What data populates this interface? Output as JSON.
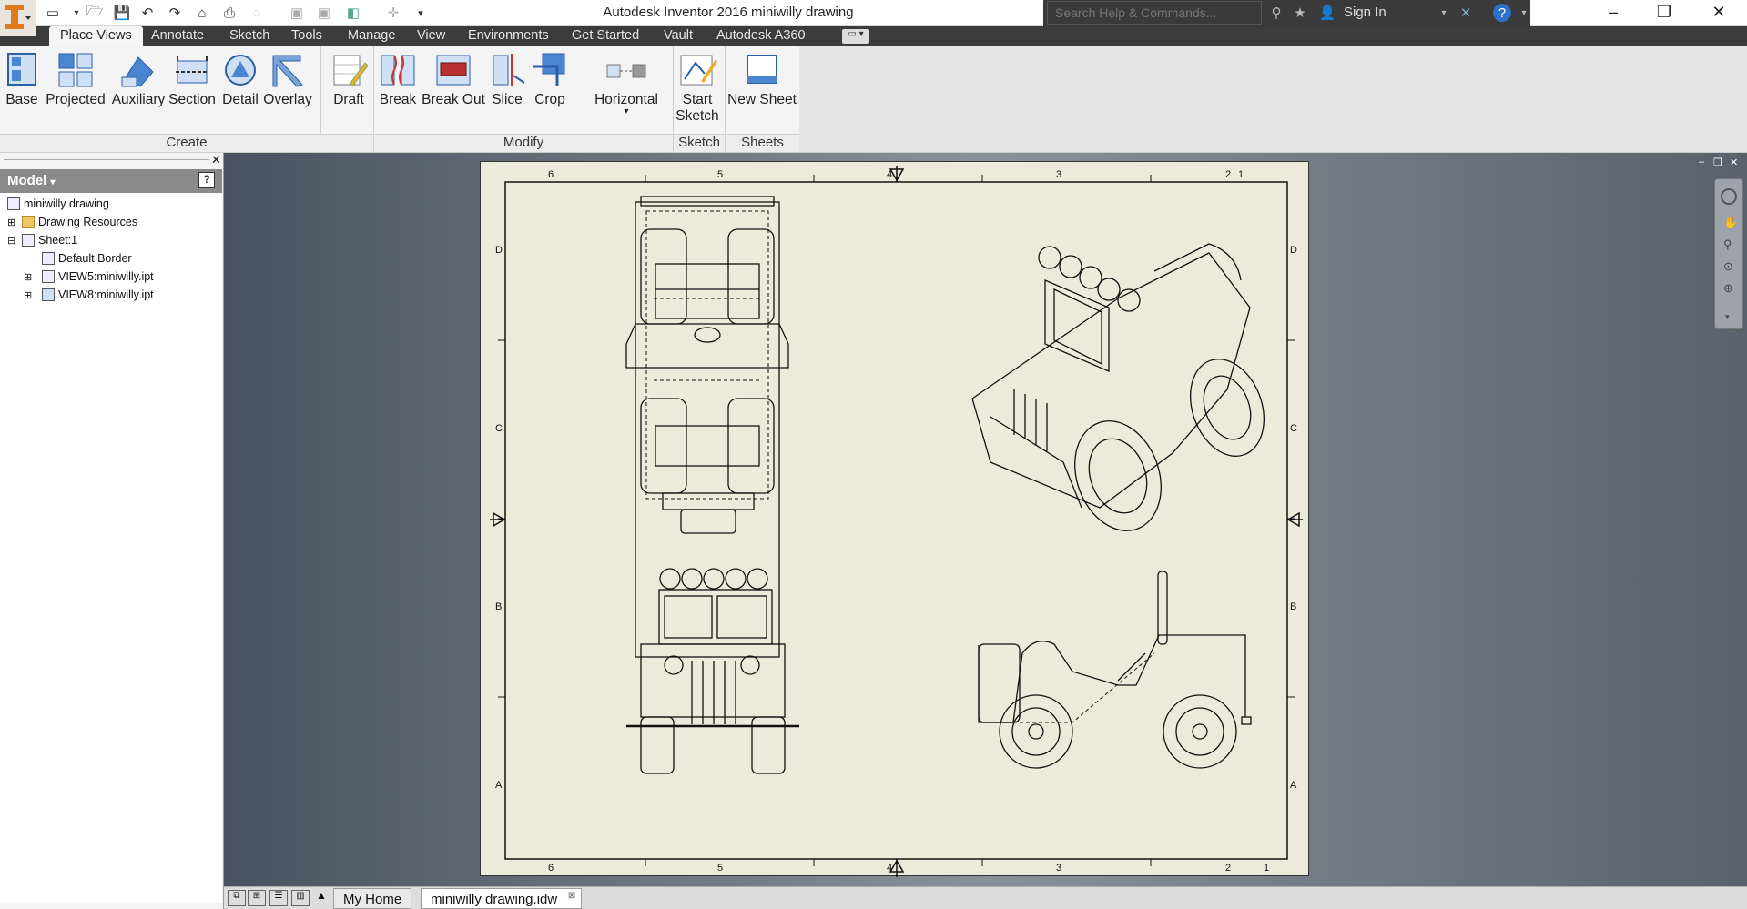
{
  "window": {
    "title": "Autodesk Inventor 2016    miniwilly drawing"
  },
  "search": {
    "placeholder": "Search Help & Commands..."
  },
  "account": {
    "sign_in": "Sign In"
  },
  "tabs": [
    "Place Views",
    "Annotate",
    "Sketch",
    "Tools",
    "Manage",
    "View",
    "Environments",
    "Get Started",
    "Vault",
    "Autodesk A360"
  ],
  "ribbon": {
    "create": {
      "label": "Create",
      "buttons": [
        "Base",
        "Projected",
        "Auxiliary",
        "Section",
        "Detail",
        "Overlay",
        "Draft"
      ]
    },
    "modify": {
      "label": "Modify",
      "buttons": [
        "Break",
        "Break Out",
        "Slice",
        "Crop",
        "Horizontal"
      ]
    },
    "sketch": {
      "label": "Sketch",
      "start_sketch_line1": "Start",
      "start_sketch_line2": "Sketch"
    },
    "sheets": {
      "label": "Sheets",
      "new_sheet": "New Sheet"
    }
  },
  "browser": {
    "header": "Model",
    "items": [
      "miniwilly drawing",
      "Drawing Resources",
      "Sheet:1",
      "Default Border",
      "VIEW5:miniwilly.ipt",
      "VIEW8:miniwilly.ipt"
    ]
  },
  "sheet": {
    "columns": [
      "6",
      "5",
      "4",
      "3",
      "2",
      "1"
    ],
    "rows": [
      "D",
      "C",
      "B",
      "A"
    ]
  },
  "document_tabs": [
    "My Home",
    "miniwilly drawing.idw"
  ],
  "colors": {
    "tab_bar": "#3c3c3c",
    "sheet_background": "#ecebd9",
    "app_accent": "#e07a1f"
  }
}
